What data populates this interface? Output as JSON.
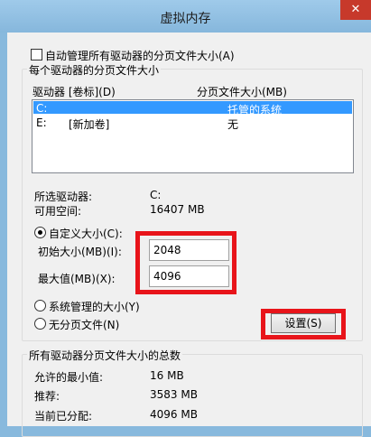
{
  "window": {
    "title": "虚拟内存",
    "close_glyph": "✕"
  },
  "auto_manage": {
    "label": "自动管理所有驱动器的分页文件大小(A)",
    "checked": false
  },
  "drives_group": {
    "title": "每个驱动器的分页文件大小",
    "col_drive": "驱动器 [卷标](D)",
    "col_size": "分页文件大小(MB)",
    "rows": [
      {
        "drive": "C:",
        "label": "",
        "size": "托管的系统",
        "selected": true
      },
      {
        "drive": "E:",
        "label": "[新加卷]",
        "size": "无",
        "selected": false
      }
    ]
  },
  "selected_drive": {
    "label": "所选驱动器:",
    "value": "C:"
  },
  "free_space": {
    "label": "可用空间:",
    "value": "16407 MB"
  },
  "custom_size": {
    "label": "自定义大小(C):",
    "selected": true
  },
  "initial_size": {
    "label": "初始大小(MB)(I):",
    "value": "2048"
  },
  "max_size": {
    "label": "最大值(MB)(X):",
    "value": "4096"
  },
  "system_managed": {
    "label": "系统管理的大小(Y)",
    "selected": false
  },
  "no_paging": {
    "label": "无分页文件(N)",
    "selected": false
  },
  "set_button": {
    "label": "设置(S)"
  },
  "totals_group": {
    "title": "所有驱动器分页文件大小的总数",
    "min_label": "允许的最小值:",
    "min_value": "16 MB",
    "rec_label": "推荐:",
    "rec_value": "3583 MB",
    "cur_label": "当前已分配:",
    "cur_value": "4096 MB"
  },
  "colors": {
    "highlight": "#e8141a",
    "selection": "#3399ff",
    "titlebar": "#88b9dd"
  }
}
